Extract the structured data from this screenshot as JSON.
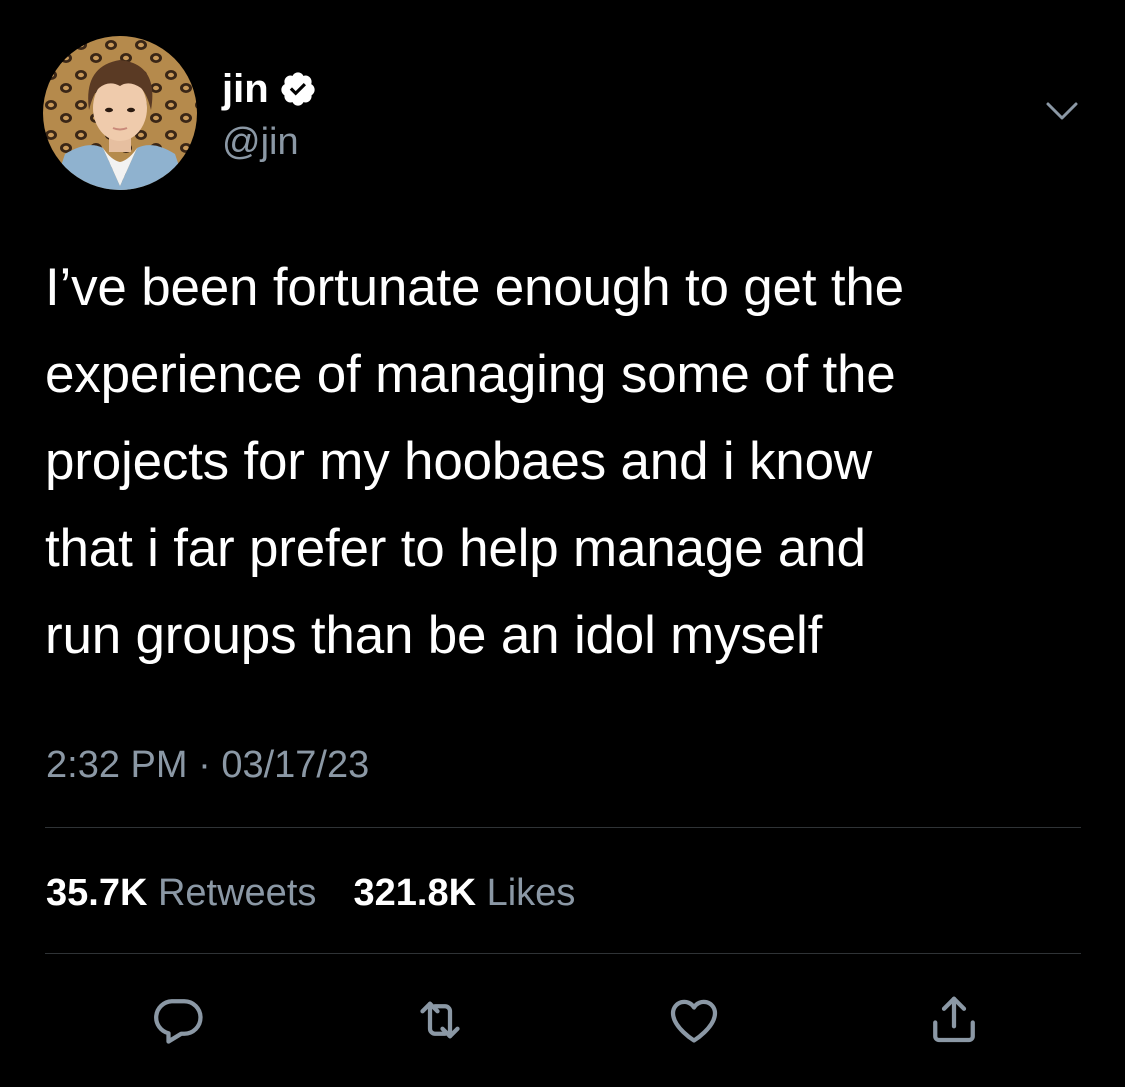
{
  "user": {
    "display_name": "jin",
    "handle": "@jin",
    "verified": true,
    "avatar_icon": "profile-photo"
  },
  "tweet": {
    "text": "I’ve been fortunate enough to get the\nexperience of managing some of the\nprojects for my hoobaes and i know\nthat i far prefer to help manage and\nrun groups than be an idol myself",
    "time": "2:32 PM",
    "separator": "·",
    "date": "03/17/23"
  },
  "stats": {
    "retweets_count": "35.7K",
    "retweets_label": "Retweets",
    "likes_count": "321.8K",
    "likes_label": "Likes"
  },
  "actions": [
    {
      "icon": "reply-icon"
    },
    {
      "icon": "retweet-icon"
    },
    {
      "icon": "like-icon"
    },
    {
      "icon": "share-icon"
    }
  ],
  "colors": {
    "background": "#000000",
    "text": "#ffffff",
    "secondary_text": "#8b98a5",
    "divider": "#2f3336",
    "verified_badge": "#ffffff"
  }
}
